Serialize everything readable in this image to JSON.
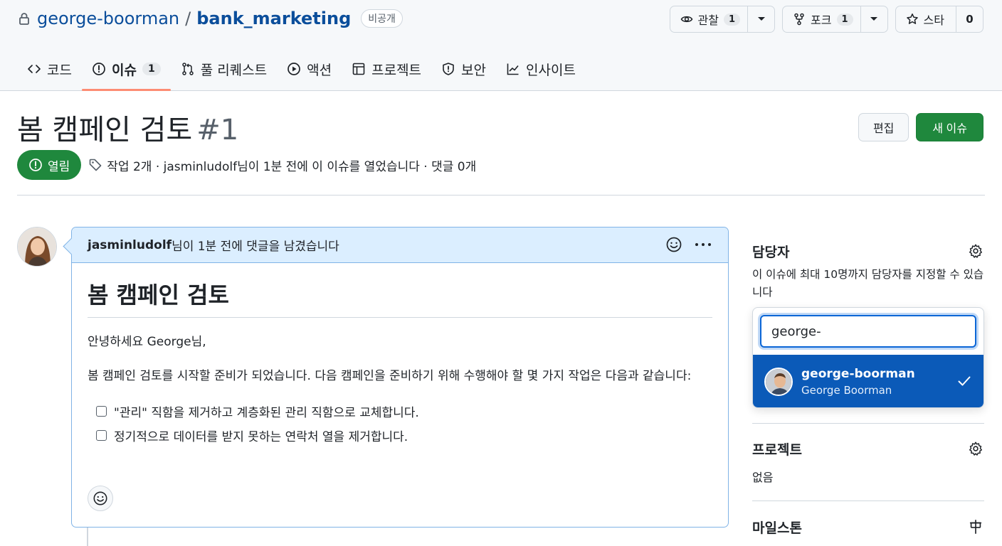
{
  "repo": {
    "owner": "george-boorman",
    "separator": "/",
    "name": "bank_marketing",
    "visibility": "비공개"
  },
  "repo_actions": {
    "watch": {
      "label": "관찰",
      "count": "1"
    },
    "fork": {
      "label": "포크",
      "count": "1"
    },
    "star": {
      "label": "스타",
      "count": "0"
    }
  },
  "tabs": [
    {
      "label": "코드",
      "icon": "code-icon"
    },
    {
      "label": "이슈",
      "icon": "issue-icon",
      "count": "1",
      "active": true
    },
    {
      "label": "풀 리퀘스트",
      "icon": "pull-request-icon"
    },
    {
      "label": "액션",
      "icon": "play-icon"
    },
    {
      "label": "프로젝트",
      "icon": "table-icon"
    },
    {
      "label": "보안",
      "icon": "shield-icon"
    },
    {
      "label": "인사이트",
      "icon": "graph-icon"
    }
  ],
  "issue": {
    "title": "봄 캠페인 검토",
    "number": "#1",
    "edit_label": "편집",
    "new_issue_label": "새 이슈",
    "state": "열림",
    "meta": "작업 2개 · jasminludolf님이 1분 전에 이 이슈를 열었습니다 · 댓글 0개"
  },
  "comment": {
    "author": "jasminludolf",
    "header_suffix": "님이 1분 전에 댓글을 남겼습니다",
    "heading": "봄 캠페인 검토",
    "greeting": "안녕하세요 George님,",
    "paragraph": "봄 캠페인 검토를 시작할 준비가 되었습니다. 다음 캠페인을 준비하기 위해 수행해야 할 몇 가지 작업은 다음과 같습니다:",
    "tasks": [
      "\"관리\" 직함을 제거하고 계층화된 관리 직함으로 교체합니다.",
      "정기적으로 데이터를 받지 못하는 연락처 열을 제거합니다."
    ]
  },
  "sidebar": {
    "assignees": {
      "title": "담당자",
      "help": "이 이슈에 최대 10명까지 담당자를 지정할 수 있습니다",
      "search_value": "george-",
      "option_login": "george-boorman",
      "option_name": "George Boorman"
    },
    "projects": {
      "title": "프로젝트",
      "value": "없음"
    },
    "milestone": {
      "title": "마일스톤"
    }
  },
  "colors": {
    "accent_blue": "#0b5ab8",
    "green": "#1f883d",
    "tab_underline": "#fd8c73",
    "comment_header": "#dbeeff"
  }
}
